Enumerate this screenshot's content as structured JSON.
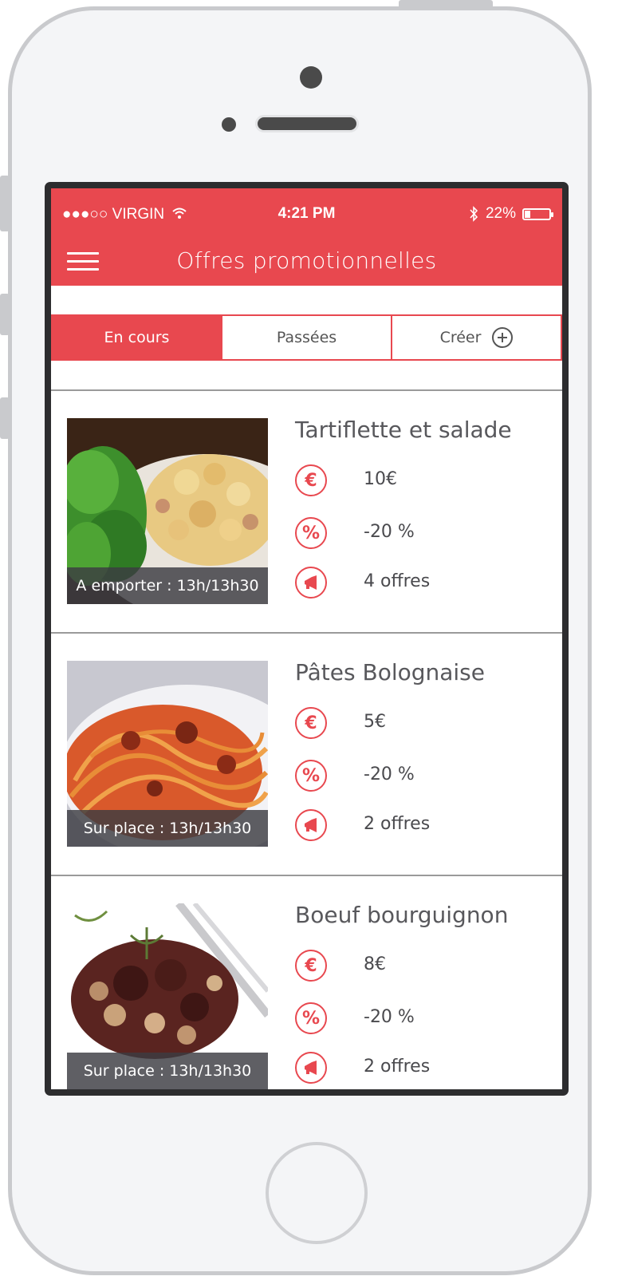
{
  "status_bar": {
    "carrier": "●●●○○ VIRGIN",
    "time": "4:21 PM",
    "battery_percent": "22%",
    "battery_level": 0.22
  },
  "nav": {
    "title": "Offres promotionnelles"
  },
  "tabs": [
    {
      "label": "En cours",
      "active": true
    },
    {
      "label": "Passées",
      "active": false
    },
    {
      "label": "Créer",
      "active": false,
      "icon": "plus-circle-icon"
    }
  ],
  "offers": [
    {
      "title": "Tartiflette et salade",
      "caption": "A emporter : 13h/13h30",
      "price": "10€",
      "discount": "-20 %",
      "count": "4 offres",
      "photo": "tartiflette"
    },
    {
      "title": "Pâtes Bolognaise",
      "caption": "Sur place : 13h/13h30",
      "price": "5€",
      "discount": "-20 %",
      "count": "2 offres",
      "photo": "spaghetti"
    },
    {
      "title": "Boeuf bourguignon",
      "caption": "Sur place : 13h/13h30",
      "price": "8€",
      "discount": "-20 %",
      "count": "2 offres",
      "photo": "boeuf"
    }
  ],
  "colors": {
    "accent": "#e8484f",
    "text": "#58585c"
  }
}
